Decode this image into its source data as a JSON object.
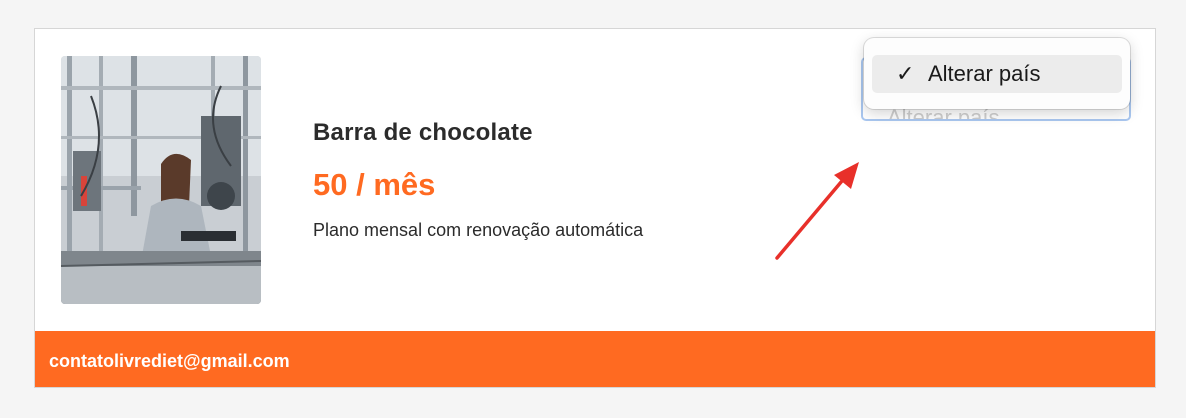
{
  "product": {
    "image": "lab-worker-photo",
    "title": "Barra de chocolate",
    "price": "50 / mês",
    "description": "Plano mensal com renovação automática"
  },
  "country_select": {
    "value": "Alterar país",
    "options": [
      {
        "label": "Alterar país",
        "selected": true,
        "icon": "check-icon"
      }
    ]
  },
  "footer": {
    "email": "contatolivrediet@gmail.com"
  },
  "colors": {
    "accent": "#ff6a21",
    "annotation_arrow": "#e8302a",
    "text": "#2b2b2b"
  }
}
